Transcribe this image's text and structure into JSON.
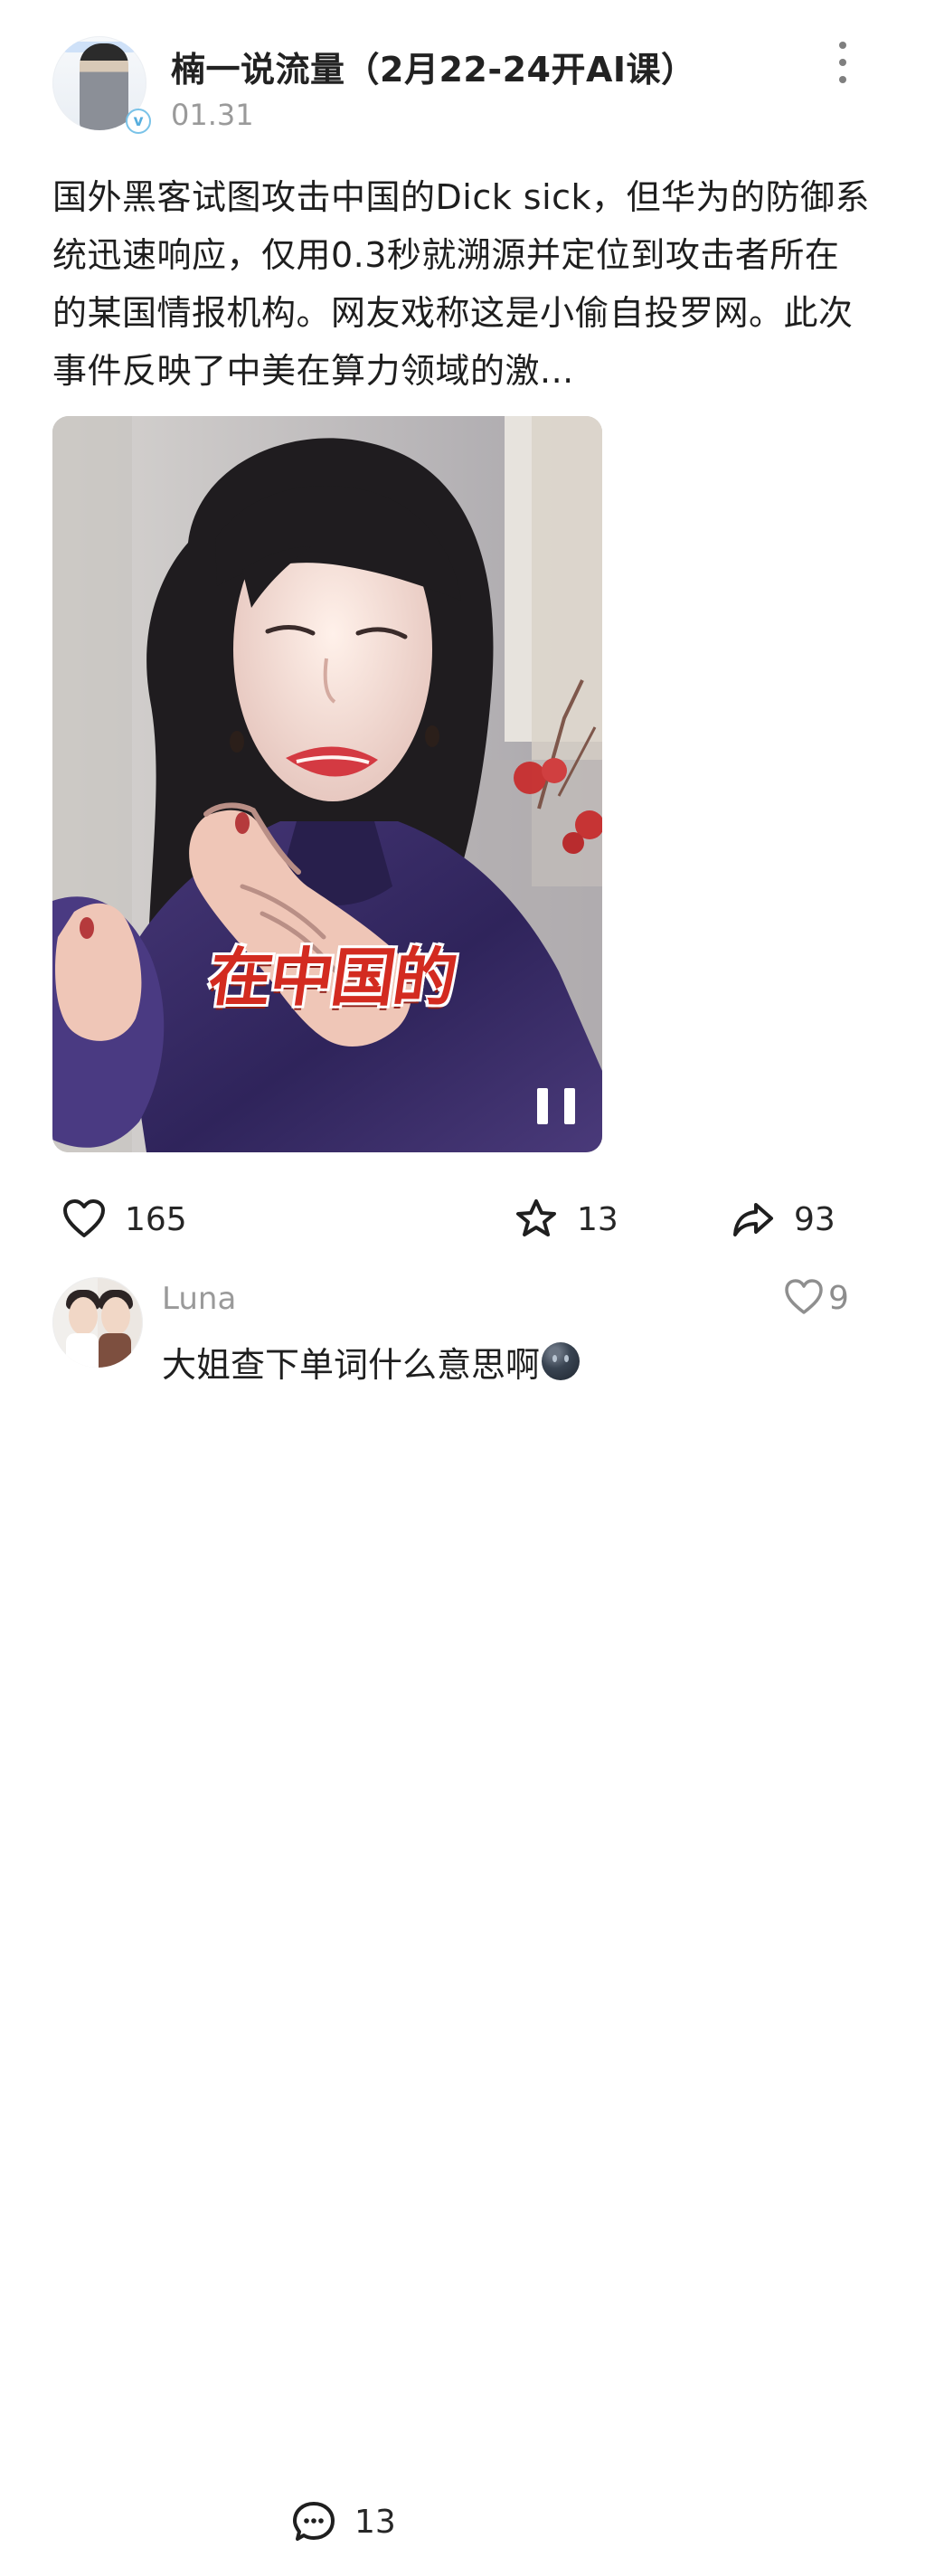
{
  "post": {
    "author_name": "楠一说流量（2月22-24开AI课）",
    "date": "01.31",
    "verified_badge": "v",
    "content": "国外黑客试图攻击中国的Dick sick，但华为的防御系统迅速响应，仅用0.3秒就溯源并定位到攻击者所在的某国情报机构。网友戏称这是小偷自投罗网。此次事件反映了中美在算力领域的激...",
    "video_caption": "在中国的"
  },
  "actions": {
    "like_count": "165",
    "comment_count": "13",
    "favorite_count": "13",
    "share_count": "93"
  },
  "comment": {
    "username": "Luna",
    "text": "大姐查下单词什么意思啊",
    "like_count": "9"
  },
  "icons": {
    "more": "more-vertical-icon",
    "pause": "pause-icon",
    "like": "heart-icon",
    "comment": "comment-icon",
    "favorite": "star-icon",
    "share": "share-icon",
    "comment_like": "heart-icon",
    "emoji": "black-face-emoji"
  },
  "colors": {
    "text_primary": "#1f1f1f",
    "text_secondary": "#9a9a9a",
    "caption_red": "#d32b20",
    "verified_blue": "#57aede",
    "video_purple": "#3a2f68"
  }
}
